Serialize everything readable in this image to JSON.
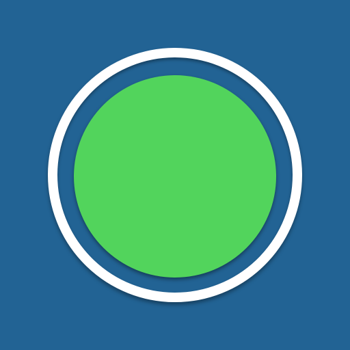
{
  "colors": {
    "background": "#226394",
    "ring": "#ffffff",
    "disc": "#52d45c"
  },
  "icon": {
    "name": "record-button-icon"
  }
}
